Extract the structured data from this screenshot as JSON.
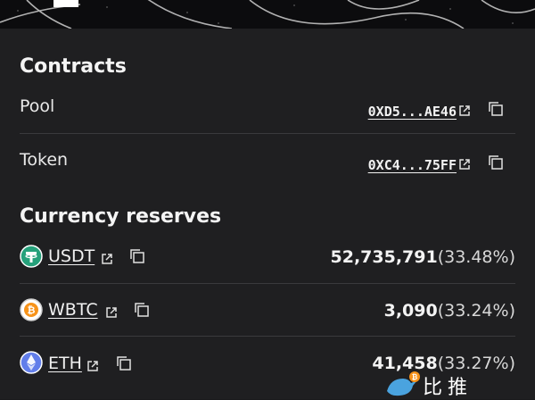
{
  "contracts": {
    "title": "Contracts",
    "rows": [
      {
        "label": "Pool",
        "address": "0XD5...AE46"
      },
      {
        "label": "Token",
        "address": "0XC4...75FF"
      }
    ]
  },
  "reserves": {
    "title": "Currency reserves",
    "items": [
      {
        "symbol": "USDT",
        "icon": "tether-icon",
        "amount": "52,735,791",
        "percent": "(33.48%)",
        "color": "#26a17b"
      },
      {
        "symbol": "WBTC",
        "icon": "wbtc-icon",
        "amount": "3,090",
        "percent": "(33.24%)",
        "color": "#e0e0e0"
      },
      {
        "symbol": "ETH",
        "icon": "eth-icon",
        "amount": "41,458",
        "percent": "(33.27%)",
        "color": "#627eea"
      }
    ]
  },
  "watermark": {
    "text": "比推"
  }
}
